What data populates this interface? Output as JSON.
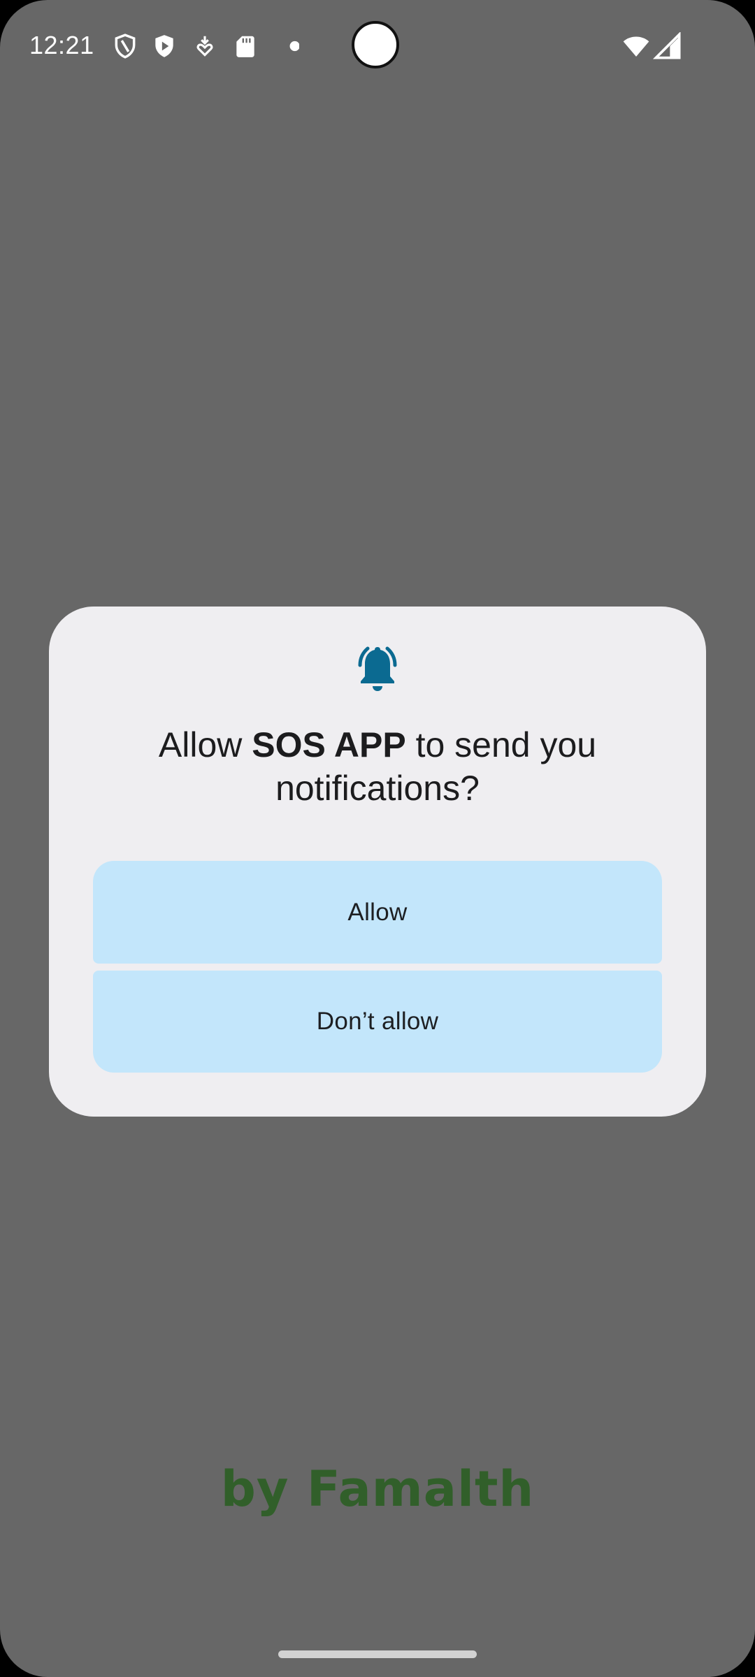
{
  "status_bar": {
    "time": "12:21",
    "icons": [
      "shield-outline-icon",
      "shield-play-icon",
      "download-heart-icon",
      "sd-card-icon",
      "dot-icon",
      "wifi-icon",
      "cellular-signal-icon"
    ]
  },
  "dialog": {
    "icon": "notification-bell-icon",
    "title_prefix": "Allow ",
    "app_name": "SOS APP",
    "title_suffix": " to send you notifications?",
    "allow_label": "Allow",
    "deny_label": "Don’t allow"
  },
  "brand": {
    "text": "by Famalth"
  },
  "colors": {
    "scrim": "#676767",
    "dialog_bg": "#efeef1",
    "button_bg": "#c3e6fb",
    "accent": "#0b6a91",
    "brand_green": "#2f5f27"
  }
}
